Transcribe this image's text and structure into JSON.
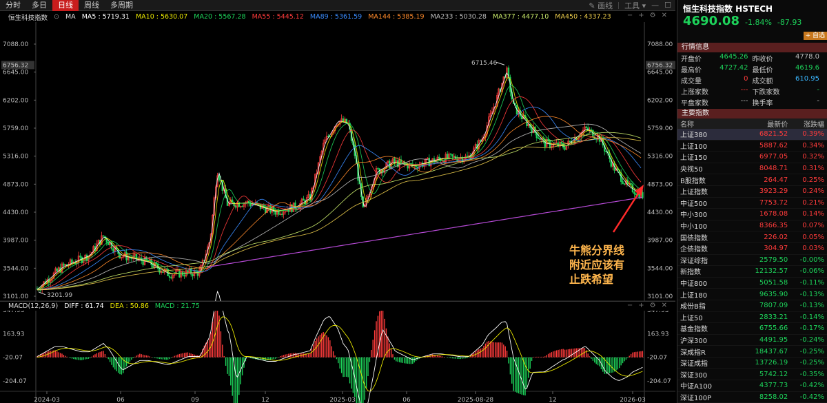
{
  "toolbar": {
    "tabs": [
      {
        "label": "分时",
        "active": false
      },
      {
        "label": "多日",
        "active": false
      },
      {
        "label": "日线",
        "active": true
      },
      {
        "label": "周线",
        "active": false
      },
      {
        "label": "多周期",
        "active": false
      }
    ],
    "draw_label": "画线",
    "tools_label": "工具"
  },
  "indicator_bar": {
    "name": "恒生科技指数",
    "type": "MA",
    "items": [
      {
        "label": "MA5 : 5719.31",
        "color": "#ffffff"
      },
      {
        "label": "MA10 : 5630.07",
        "color": "#e8e600"
      },
      {
        "label": "MA20 : 5567.28",
        "color": "#1dd35a"
      },
      {
        "label": "MA55 : 5445.12",
        "color": "#ff3b3b"
      },
      {
        "label": "MA89 : 5361.59",
        "color": "#3a8cff"
      },
      {
        "label": "MA144 : 5385.19",
        "color": "#ff8a2a"
      },
      {
        "label": "MA233 : 5030.28",
        "color": "#bbbbbb"
      },
      {
        "label": "MA377 : 4477.10",
        "color": "#c8e86a"
      },
      {
        "label": "MA450 : 4337.23",
        "color": "#e8c94a"
      }
    ]
  },
  "price_axis": {
    "ticks": [
      "7088.00",
      "6645.00",
      "6202.00",
      "5759.00",
      "5316.00",
      "4873.00",
      "4430.00",
      "3987.00",
      "3544.00",
      "3101.00"
    ],
    "highlight": "6756.32"
  },
  "extremes": {
    "high_label": "6715.46",
    "low_label": "3201.99"
  },
  "annotation": {
    "line1": "牛熊分界线",
    "line2": "附近应该有",
    "line3": "止跌希望"
  },
  "macd_bar": {
    "name": "MACD(12,26,9)",
    "items": [
      {
        "label": "DIFF : 61.74",
        "color": "#ffffff"
      },
      {
        "label": "DEA : 50.86",
        "color": "#e8e600"
      },
      {
        "label": "MACD : 21.75",
        "color": "#1dd35a"
      }
    ]
  },
  "macd_axis": {
    "ticks": [
      "347.93",
      "163.93",
      "-20.07",
      "-204.07"
    ]
  },
  "time_axis": {
    "ticks": [
      "2024-03",
      "06",
      "09",
      "12",
      "2025-03",
      "06",
      "2025-08-28",
      "12",
      "2026-03"
    ]
  },
  "quote": {
    "title": "恒生科技指数 HSTECH",
    "price": "4690.08",
    "change_pct": "-1.84%",
    "change": "-87.93",
    "fav_label": "+ 自选"
  },
  "market_info": {
    "header": "行情信息",
    "rows": [
      [
        {
          "label": "开盘价",
          "value": "4645.26",
          "cls": "down"
        },
        {
          "label": "昨收价",
          "value": "4778.0",
          "cls": "flat"
        }
      ],
      [
        {
          "label": "最高价",
          "value": "4727.42",
          "cls": "down"
        },
        {
          "label": "最低价",
          "value": "4619.6",
          "cls": "down"
        }
      ],
      [
        {
          "label": "成交量",
          "value": "0",
          "cls": "up"
        },
        {
          "label": "成交额",
          "value": "610.95",
          "cls": "cyan"
        }
      ],
      [
        {
          "label": "上涨家数",
          "value": "---",
          "cls": "up"
        },
        {
          "label": "下跌家数",
          "value": "-",
          "cls": "down"
        }
      ],
      [
        {
          "label": "平盘家数",
          "value": "---",
          "cls": "flat"
        },
        {
          "label": "换手率",
          "value": "-",
          "cls": "flat"
        }
      ]
    ]
  },
  "major_indices": {
    "header": "主要指数",
    "columns": [
      "名称",
      "最新价",
      "涨跌幅"
    ],
    "rows": [
      {
        "name": "上证380",
        "price": "6821.52",
        "pct": "0.39%",
        "cls": "up"
      },
      {
        "name": "上证100",
        "price": "5887.62",
        "pct": "0.34%",
        "cls": "up"
      },
      {
        "name": "上证150",
        "price": "6977.05",
        "pct": "0.32%",
        "cls": "up"
      },
      {
        "name": "央视50",
        "price": "8048.71",
        "pct": "0.31%",
        "cls": "up"
      },
      {
        "name": "B股指数",
        "price": "264.47",
        "pct": "0.25%",
        "cls": "up"
      },
      {
        "name": "上证指数",
        "price": "3923.29",
        "pct": "0.24%",
        "cls": "up"
      },
      {
        "name": "中证500",
        "price": "7753.72",
        "pct": "0.21%",
        "cls": "up"
      },
      {
        "name": "中小300",
        "price": "1678.08",
        "pct": "0.14%",
        "cls": "up"
      },
      {
        "name": "中小100",
        "price": "8366.35",
        "pct": "0.07%",
        "cls": "up"
      },
      {
        "name": "国债指数",
        "price": "226.02",
        "pct": "0.05%",
        "cls": "up"
      },
      {
        "name": "企债指数",
        "price": "304.97",
        "pct": "0.03%",
        "cls": "up"
      },
      {
        "name": "深证综指",
        "price": "2579.50",
        "pct": "-0.00%",
        "cls": "down"
      },
      {
        "name": "新指数",
        "price": "12132.57",
        "pct": "-0.06%",
        "cls": "down"
      },
      {
        "name": "中证800",
        "price": "5051.58",
        "pct": "-0.11%",
        "cls": "down"
      },
      {
        "name": "上证180",
        "price": "9635.90",
        "pct": "-0.13%",
        "cls": "down"
      },
      {
        "name": "成份B指",
        "price": "7807.09",
        "pct": "-0.13%",
        "cls": "down"
      },
      {
        "name": "上证50",
        "price": "2833.21",
        "pct": "-0.14%",
        "cls": "down"
      },
      {
        "name": "基金指数",
        "price": "6755.66",
        "pct": "-0.17%",
        "cls": "down"
      },
      {
        "name": "沪深300",
        "price": "4491.95",
        "pct": "-0.24%",
        "cls": "down"
      },
      {
        "name": "深成指R",
        "price": "18437.67",
        "pct": "-0.25%",
        "cls": "down"
      },
      {
        "name": "深证成指",
        "price": "13726.19",
        "pct": "-0.25%",
        "cls": "down"
      },
      {
        "name": "深证300",
        "price": "5742.12",
        "pct": "-0.35%",
        "cls": "down"
      },
      {
        "name": "中证A100",
        "price": "4377.73",
        "pct": "-0.42%",
        "cls": "down"
      },
      {
        "name": "深证100P",
        "price": "8258.02",
        "pct": "-0.42%",
        "cls": "down"
      }
    ]
  }
}
